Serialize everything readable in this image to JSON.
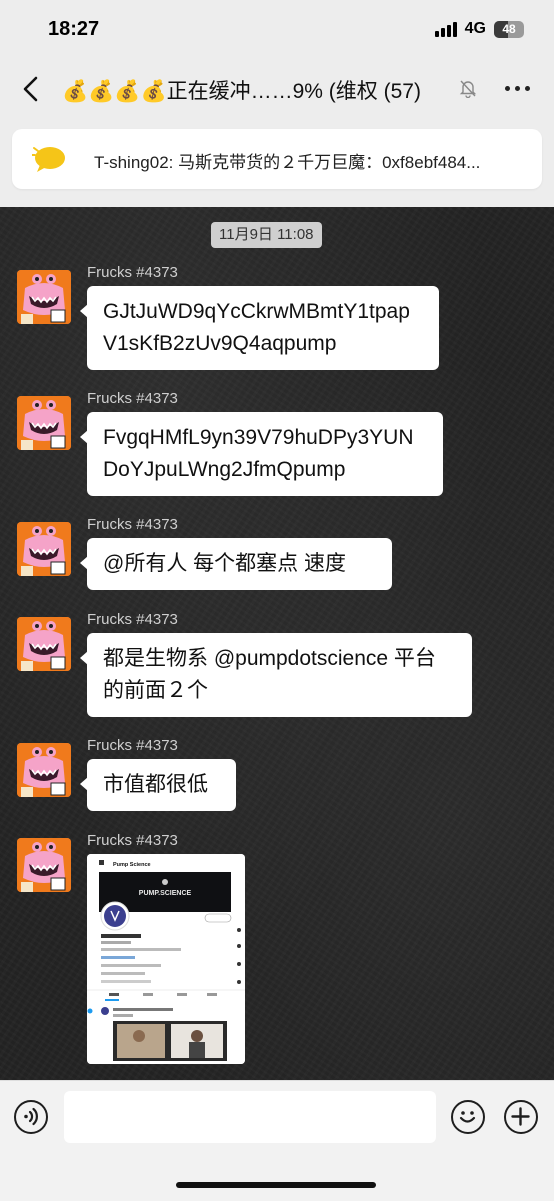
{
  "status_bar": {
    "time": "18:27",
    "network": "4G",
    "battery": "48"
  },
  "nav": {
    "title": "💰💰💰💰正在缓冲……9% (维权 (57)",
    "back_icon": "chevron-left-icon",
    "mute_icon": "bell-off-icon",
    "more_icon": "more-horizontal-icon"
  },
  "pinned": {
    "icon": "speech-bubble-icon",
    "text": "T-shing02: 马斯克带货的２千万巨魔：0xf8ebf484..."
  },
  "chat": {
    "date_label": "11月9日 11:08",
    "messages": [
      {
        "sender": "Frucks #4373",
        "text": "GJtJuWD9qYcCkrwMBmtY1tpapV1sKfB2zUv9Q4aqpump"
      },
      {
        "sender": "Frucks #4373",
        "text": "FvgqHMfL9yn39V79huDPy3YUNDoYJpuLWng2JfmQpump"
      },
      {
        "sender": "Frucks #4373",
        "text": "@所有人 每个都塞点  速度"
      },
      {
        "sender": "Frucks #4373",
        "text": "都是生物系  @pumpdotscience  平台的前面２个"
      },
      {
        "sender": "Frucks #4373",
        "text": "市值都很低"
      },
      {
        "sender": "Frucks #4373",
        "image": {
          "profile_name": "Pump Science",
          "banner_text": "PUMP.SCIENCE"
        }
      }
    ]
  },
  "input_bar": {
    "placeholder": "",
    "voice_icon": "voice-icon",
    "emoji_icon": "smiley-icon",
    "plus_icon": "plus-icon"
  },
  "colors": {
    "accent_orange": "#f07a1c",
    "avatar_pink": "#f5a3c8",
    "chat_background": "#242424"
  }
}
